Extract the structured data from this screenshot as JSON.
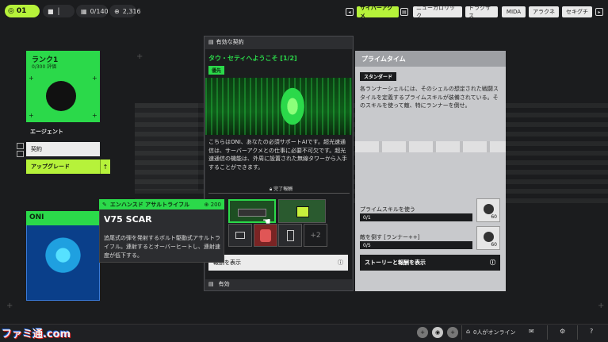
{
  "topbar": {
    "level": "01",
    "currency1": "",
    "inventory": "0/140",
    "credits": "2,316",
    "tabs": [
      {
        "label": "サイバーアクメ",
        "active": true
      },
      {
        "label": "ニューカロリック",
        "active": false
      },
      {
        "label": "トラクサス",
        "active": false
      },
      {
        "label": "MIDA",
        "active": false
      },
      {
        "label": "アラクネ",
        "active": false
      },
      {
        "label": "セキグチ",
        "active": false
      }
    ]
  },
  "rank": {
    "title": "ランク1",
    "sub": "0/300 評価",
    "agent_label": "エージェント"
  },
  "menu": {
    "contract": "契約",
    "upgrade": "アップグレード"
  },
  "oni": {
    "name": "ONI"
  },
  "tooltip": {
    "category": "エンハンスド アサルトライフル",
    "cost": "200",
    "name": "V75 SCAR",
    "desc": "追尾式の弾を発射するボルト駆動式アサルトライフル。連射するとオーバーヒートし、連射速度が低下する。"
  },
  "contract_panel": {
    "header": "有効な契約",
    "title": "タウ・セティへようこそ [1/2]",
    "badge": "優先",
    "text": "こちらはONI、あなたの必須サポートAIです。超光速通信は、サーバーアクメとの仕事に必要不可欠です。超光速通信の機能は、外周に設置された無線タワーから入手することができます。",
    "reward_label": "完了報酬",
    "extra_count": "+2",
    "show_button": "報酬を表示",
    "footer": "有効"
  },
  "prime_panel": {
    "header": "プライムタイム",
    "tag": "スタンダード",
    "desc": "各ランナーシェルには、そのシェルの想定された戦闘スタイルを定義するプライムスキルが装備されている。そのスキルを使って敵、特にランナーを倒せ。",
    "tasks": [
      {
        "label": "プライムスキルを使う",
        "progress": "0/1",
        "reward": "60"
      },
      {
        "label": "敵を倒す [ランナー++]",
        "progress": "0/5",
        "reward": "60"
      }
    ],
    "story_button": "ストーリーと報酬を表示"
  },
  "bottombar": {
    "watermark": "ファミ通.com",
    "online": "0人がオンライン"
  },
  "colors": {
    "accent_green": "#2bd94a",
    "lime": "#b6f23a",
    "background": "#1b1c1e"
  }
}
